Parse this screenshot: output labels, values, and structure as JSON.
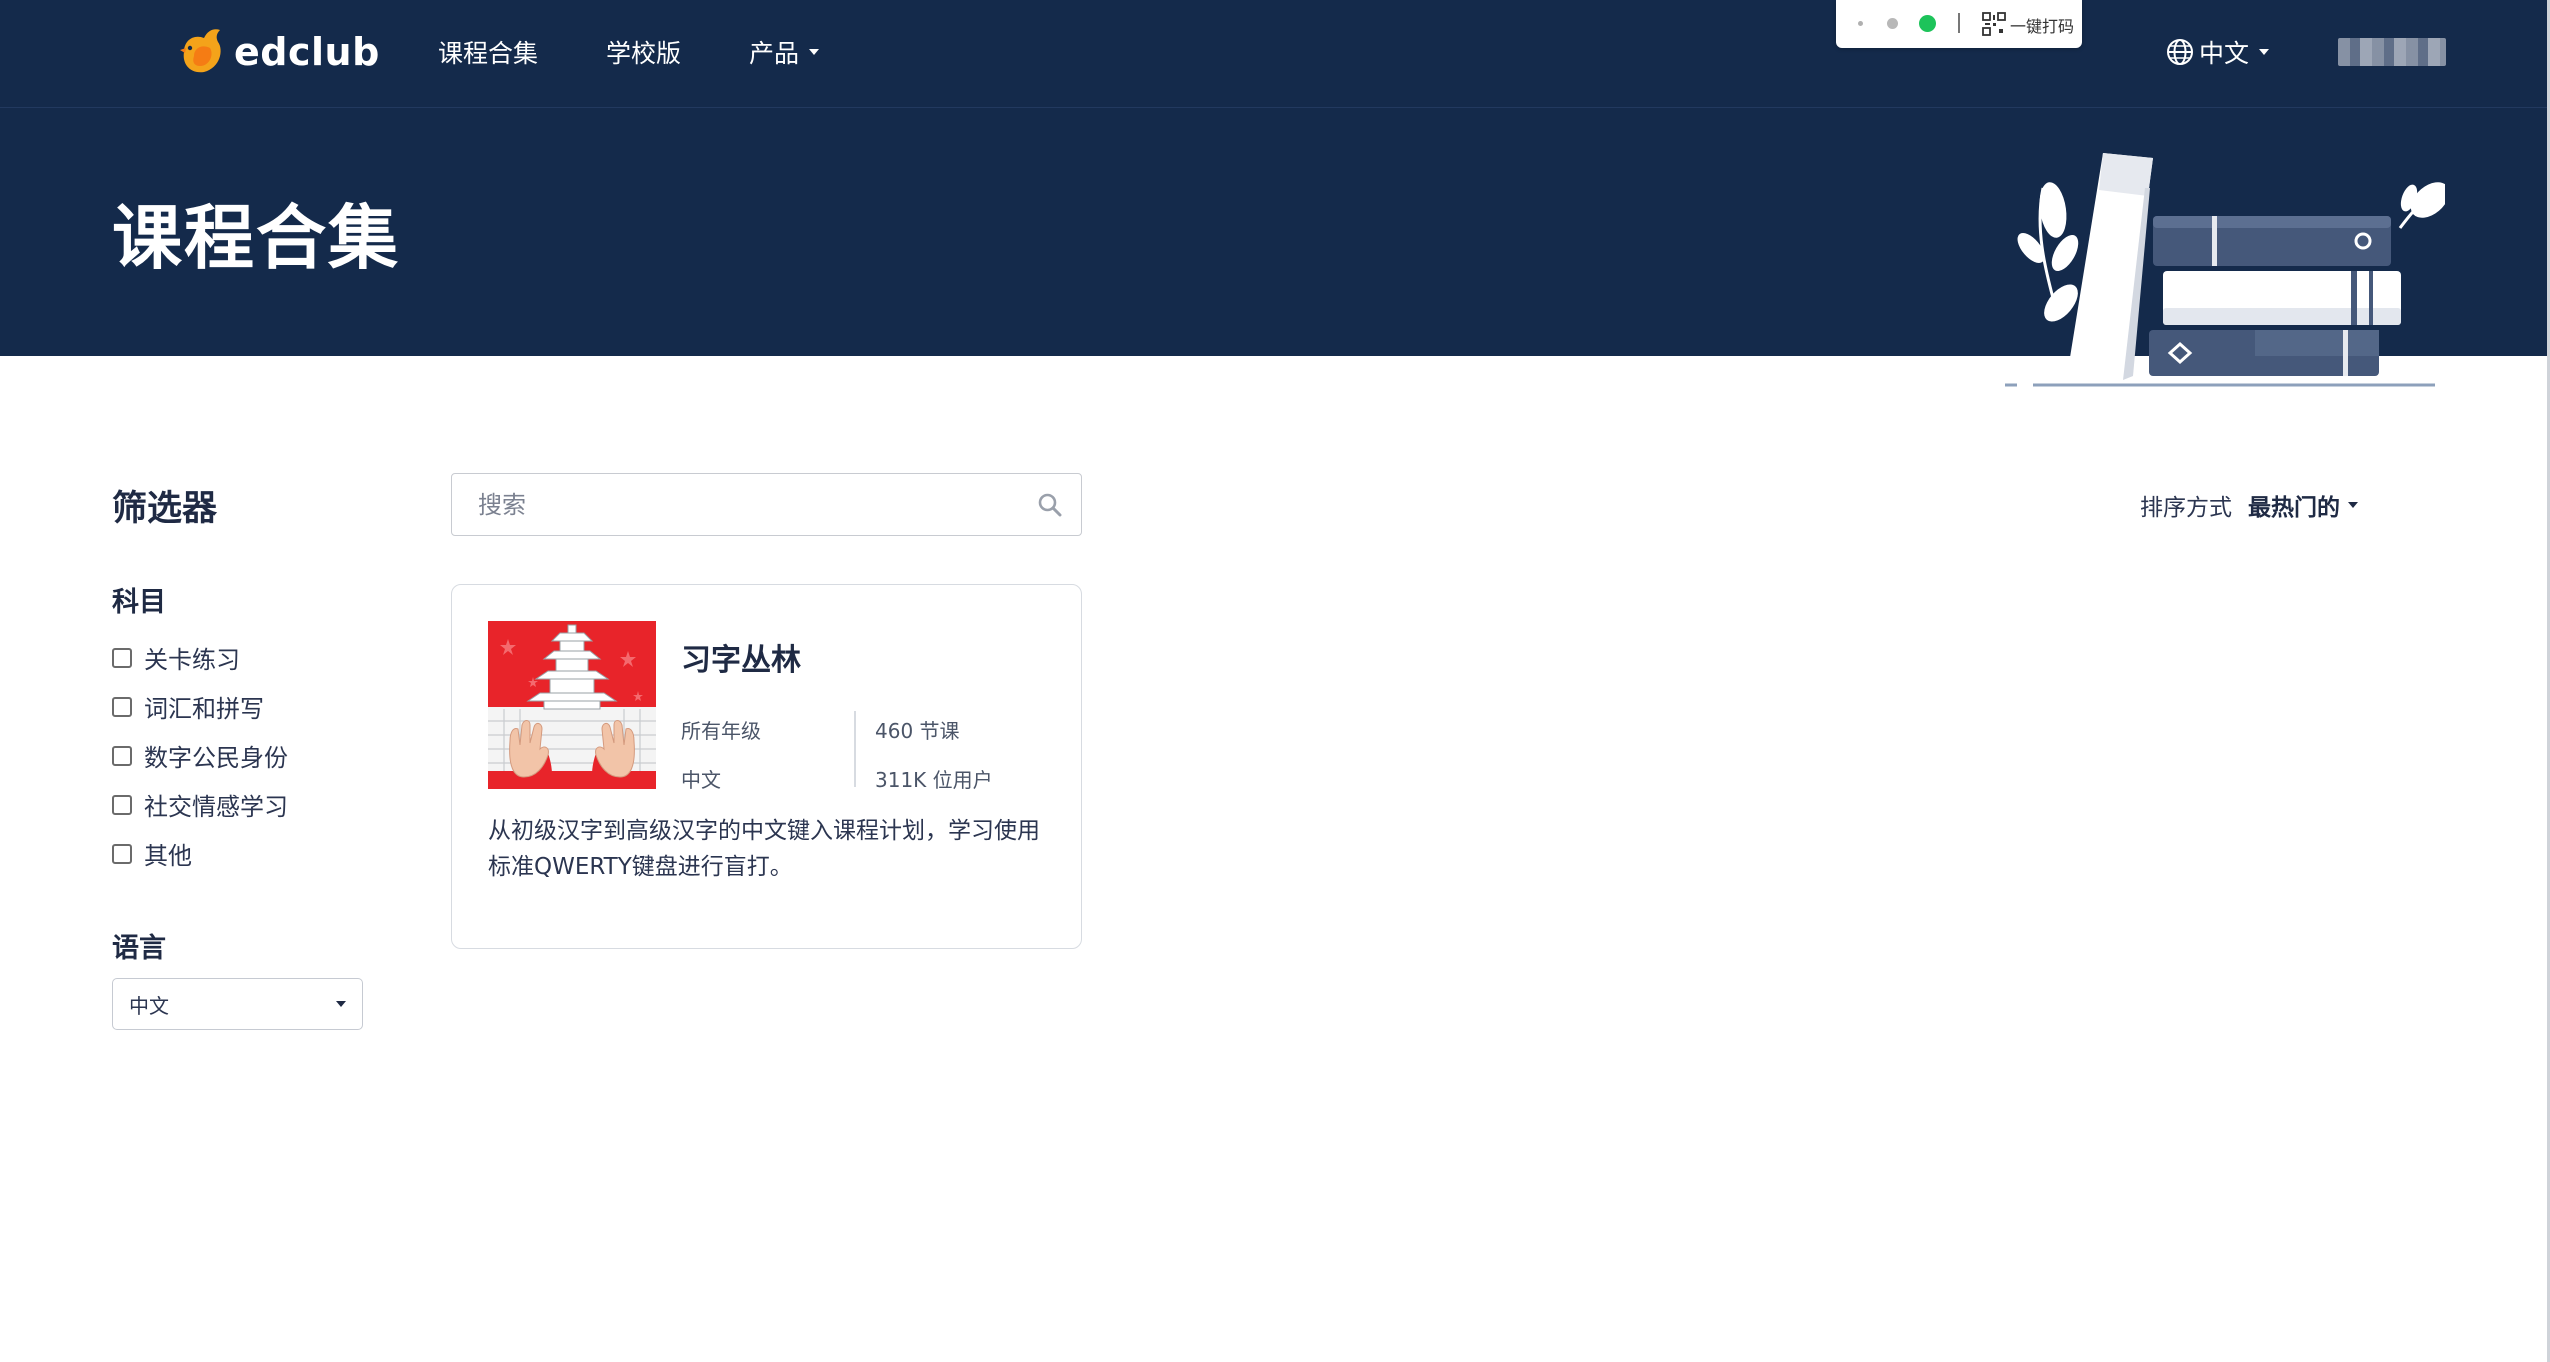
{
  "header": {
    "logo_text": "edclub",
    "nav": [
      {
        "label": "课程合集"
      },
      {
        "label": "学校版"
      },
      {
        "label": "产品"
      }
    ],
    "language": "中文"
  },
  "extension": {
    "label": "一键打码"
  },
  "banner": {
    "title": "课程合集"
  },
  "sidebar": {
    "title": "筛选器",
    "subject_title": "科目",
    "subjects": [
      "关卡练习",
      "词汇和拼写",
      "数字公民身份",
      "社交情感学习",
      "其他"
    ],
    "language_title": "语言",
    "language_selected": "中文"
  },
  "search": {
    "placeholder": "搜索",
    "value": ""
  },
  "sort": {
    "label": "排序方式",
    "value": "最热门的"
  },
  "courses": [
    {
      "title": "习字丛林",
      "grade": "所有年级",
      "lessons": "460 节课",
      "language": "中文",
      "users": "311K 位用户",
      "description": "从初级汉字到高级汉字的中文键入课程计划，学习使用标准QWERTY键盘进行盲打。"
    }
  ],
  "colors": {
    "header_bg": "#142a4b",
    "thumb_red": "#e8242a",
    "status_green": "#1dc35a"
  }
}
